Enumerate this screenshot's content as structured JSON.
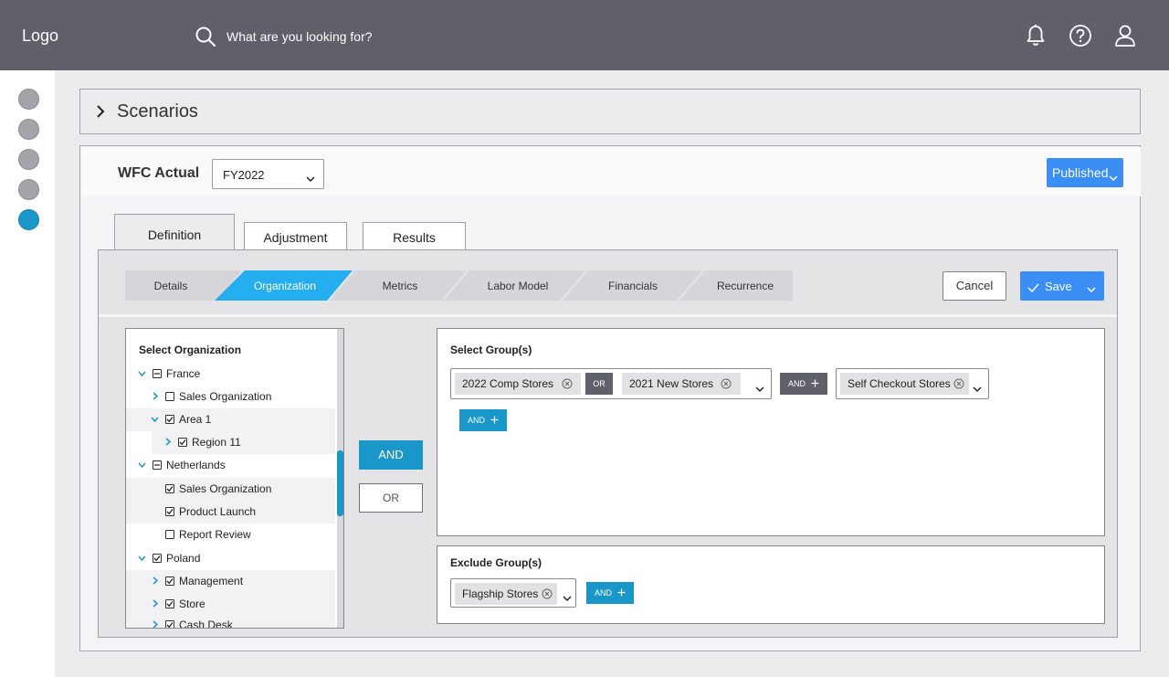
{
  "header": {
    "logo": "Logo",
    "search_placeholder": "What are you looking for?"
  },
  "scenarios": {
    "label": "Scenarios"
  },
  "panel": {
    "title": "WFC Actual",
    "fiscal_year": "FY2022",
    "status": "Published"
  },
  "tabs": [
    "Definition",
    "Adjustment",
    "Results"
  ],
  "steps": [
    "Details",
    "Organization",
    "Metrics",
    "Labor Model",
    "Financials",
    "Recurrence"
  ],
  "actions": {
    "cancel": "Cancel",
    "save": "Save"
  },
  "org": {
    "title": "Select Organization",
    "rows": [
      {
        "label": "France",
        "state": "partial"
      },
      {
        "label": "Sales Organization",
        "state": "unchecked"
      },
      {
        "label": "Area 1",
        "state": "checked"
      },
      {
        "label": "Region 11",
        "state": "checked"
      },
      {
        "label": "Netherlands",
        "state": "partial"
      },
      {
        "label": "Sales Organization",
        "state": "checked"
      },
      {
        "label": "Product Launch",
        "state": "checked"
      },
      {
        "label": "Report Review",
        "state": "unchecked"
      },
      {
        "label": "Poland",
        "state": "checked"
      },
      {
        "label": "Management",
        "state": "checked"
      },
      {
        "label": "Store",
        "state": "checked"
      },
      {
        "label": "Cash Desk",
        "state": "checked"
      }
    ]
  },
  "logic": {
    "and": "AND",
    "or": "OR"
  },
  "select_groups": {
    "title": "Select Group(s)",
    "chips": [
      "2022 Comp Stores",
      "2021 New Stores"
    ],
    "or_label": "OR",
    "and_label": "AND",
    "chips2": [
      "Self Checkout Stores"
    ]
  },
  "exclude_groups": {
    "title": "Exclude Group(s)",
    "chips": [
      "Flagship Stores"
    ],
    "and_label": "AND"
  },
  "colors": {
    "accent": "#1a97c9",
    "primary": "#3a8ef6",
    "topbar": "#5f6069"
  }
}
